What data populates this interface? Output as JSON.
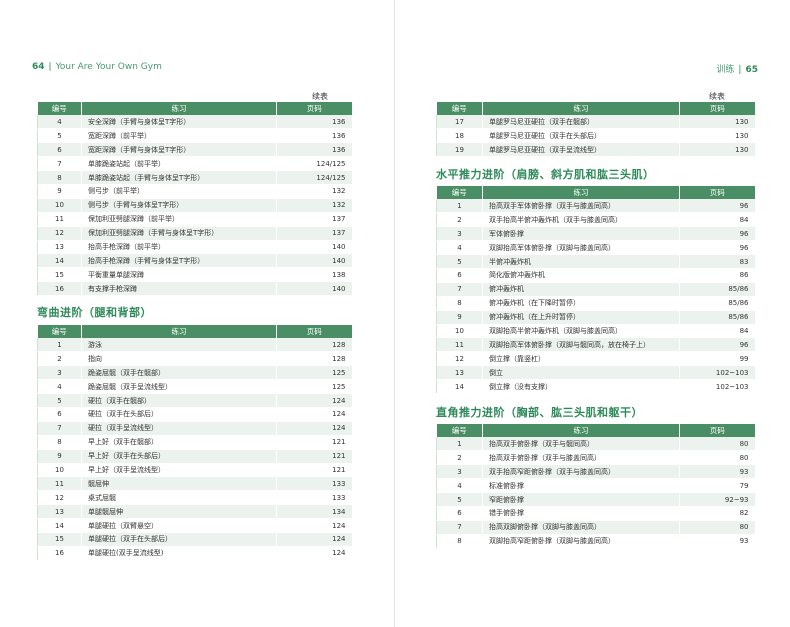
{
  "left_page": {
    "page_number": "64",
    "running_title": "Your Are Your Own Gym",
    "continued_label": "续表",
    "table1": {
      "headers": [
        "编号",
        "练习",
        "页码"
      ],
      "rows": [
        [
          "4",
          "安全深蹲（手臂与身体呈T字形）",
          "136"
        ],
        [
          "5",
          "宽距深蹲（前平举）",
          "136"
        ],
        [
          "6",
          "宽距深蹲（手臂与身体呈T字形）",
          "136"
        ],
        [
          "7",
          "单膝跪姿站起（前平举）",
          "124/125"
        ],
        [
          "8",
          "单膝跪姿站起（手臂与身体呈T字形）",
          "124/125"
        ],
        [
          "9",
          "侧弓步（前平举）",
          "132"
        ],
        [
          "10",
          "侧弓步（手臂与身体呈T字形）",
          "132"
        ],
        [
          "11",
          "保加利亚劈腿深蹲（前平举）",
          "137"
        ],
        [
          "12",
          "保加利亚劈腿深蹲（手臂与身体呈T字形）",
          "137"
        ],
        [
          "13",
          "抬高手枪深蹲（前平举）",
          "140"
        ],
        [
          "14",
          "抬高手枪深蹲（手臂与身体呈T字形）",
          "140"
        ],
        [
          "15",
          "平衡重量单腿深蹲",
          "138"
        ],
        [
          "16",
          "有支撑手枪深蹲",
          "140"
        ]
      ]
    },
    "section2_title": "弯曲进阶（腿和背部）",
    "table2": {
      "headers": [
        "编号",
        "练习",
        "页码"
      ],
      "rows": [
        [
          "1",
          "游泳",
          "128"
        ],
        [
          "2",
          "指向",
          "128"
        ],
        [
          "3",
          "跪姿屈髋（双手在髋部）",
          "125"
        ],
        [
          "4",
          "跪姿屈髋（双手呈流线型）",
          "125"
        ],
        [
          "5",
          "硬拉（双手在髋部）",
          "124"
        ],
        [
          "6",
          "硬拉（双手在头部后）",
          "124"
        ],
        [
          "7",
          "硬拉（双手呈流线型）",
          "124"
        ],
        [
          "8",
          "早上好（双手在髋部）",
          "121"
        ],
        [
          "9",
          "早上好（双手在头部后）",
          "121"
        ],
        [
          "10",
          "早上好（双手呈流线型）",
          "121"
        ],
        [
          "11",
          "髋屈伸",
          "133"
        ],
        [
          "12",
          "桌式屈髋",
          "133"
        ],
        [
          "13",
          "单腿髋屈伸",
          "134"
        ],
        [
          "14",
          "单腿硬拉（双臂悬空）",
          "124"
        ],
        [
          "15",
          "单腿硬拉（双手在头部后）",
          "124"
        ],
        [
          "16",
          "单腿硬拉(双手呈流线型)",
          "124"
        ]
      ]
    }
  },
  "right_page": {
    "page_number": "65",
    "running_title": "训练",
    "continued_label": "续表",
    "table1": {
      "headers": [
        "编号",
        "练习",
        "页码"
      ],
      "rows": [
        [
          "17",
          "单腿罗马尼亚硬拉（双手在髋部）",
          "130"
        ],
        [
          "18",
          "单腿罗马尼亚硬拉（双手在头部后）",
          "130"
        ],
        [
          "19",
          "单腿罗马尼亚硬拉（双手呈流线型）",
          "130"
        ]
      ]
    },
    "section2_title": "水平推力进阶（肩膀、斜方肌和肱三头肌）",
    "table2": {
      "headers": [
        "编号",
        "练习",
        "页码"
      ],
      "rows": [
        [
          "1",
          "抬高双手军体俯卧撑（双手与膝盖同高）",
          "96"
        ],
        [
          "2",
          "双手抬高半俯冲轰炸机（双手与膝盖同高）",
          "84"
        ],
        [
          "3",
          "军体俯卧撑",
          "96"
        ],
        [
          "4",
          "双脚抬高军体俯卧撑（双脚与膝盖同高）",
          "96"
        ],
        [
          "5",
          "半俯冲轰炸机",
          "83"
        ],
        [
          "6",
          "简化版俯冲轰炸机",
          "86"
        ],
        [
          "7",
          "俯冲轰炸机",
          "85/86"
        ],
        [
          "8",
          "俯冲轰炸机（在下降时暂停）",
          "85/86"
        ],
        [
          "9",
          "俯冲轰炸机（在上升时暂停）",
          "85/86"
        ],
        [
          "10",
          "双脚抬高半俯冲轰炸机（双脚与膝盖同高）",
          "84"
        ],
        [
          "11",
          "双脚抬高军体俯卧撑（双脚与髋同高，放在椅子上）",
          "96"
        ],
        [
          "12",
          "倒立撑（靠竖杠）",
          "99"
        ],
        [
          "13",
          "倒立",
          "102~103"
        ],
        [
          "14",
          "倒立撑（没有支撑）",
          "102~103"
        ]
      ]
    },
    "section3_title": "直角推力进阶（胸部、肱三头肌和躯干）",
    "table3": {
      "headers": [
        "编号",
        "练习",
        "页码"
      ],
      "rows": [
        [
          "1",
          "抬高双手俯卧撑（双手与髋同高）",
          "80"
        ],
        [
          "2",
          "抬高双手俯卧撑（双手与膝盖同高）",
          "80"
        ],
        [
          "3",
          "双手抬高窄距俯卧撑（双手与膝盖同高）",
          "93"
        ],
        [
          "4",
          "标准俯卧撑",
          "79"
        ],
        [
          "5",
          "窄距俯卧撑",
          "92~93"
        ],
        [
          "6",
          "错手俯卧撑",
          "82"
        ],
        [
          "7",
          "抬高双脚俯卧撑（双脚与膝盖同高）",
          "80"
        ],
        [
          "8",
          "双脚抬高窄距俯卧撑（双脚与膝盖同高）",
          "93"
        ]
      ]
    }
  }
}
